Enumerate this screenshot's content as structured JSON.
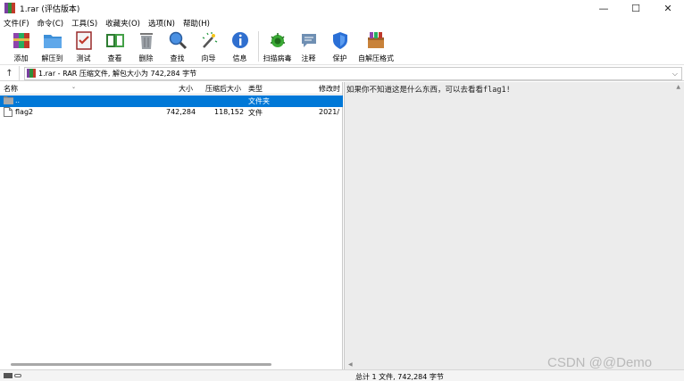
{
  "window": {
    "title": "1.rar (评估版本)",
    "controls": {
      "minimize": "—",
      "maximize": "☐",
      "close": "✕"
    }
  },
  "menu": [
    "文件(F)",
    "命令(C)",
    "工具(S)",
    "收藏夹(O)",
    "选项(N)",
    "帮助(H)"
  ],
  "toolbar": [
    {
      "label": "添加",
      "icon": "add-archive-icon"
    },
    {
      "label": "解压到",
      "icon": "extract-to-icon"
    },
    {
      "label": "测试",
      "icon": "test-icon"
    },
    {
      "label": "查看",
      "icon": "view-icon"
    },
    {
      "label": "删除",
      "icon": "delete-icon"
    },
    {
      "label": "查找",
      "icon": "find-icon"
    },
    {
      "label": "向导",
      "icon": "wizard-icon"
    },
    {
      "label": "信息",
      "icon": "info-icon"
    },
    {
      "label": "扫描病毒",
      "icon": "scan-virus-icon"
    },
    {
      "label": "注释",
      "icon": "comment-icon"
    },
    {
      "label": "保护",
      "icon": "protect-icon"
    },
    {
      "label": "自解压格式",
      "icon": "sfx-icon"
    }
  ],
  "address": {
    "up_glyph": "↑",
    "text": "1.rar - RAR 压缩文件, 解包大小为 742,284 字节",
    "dropdown_glyph": "⌵"
  },
  "columns": {
    "name": "名称",
    "size": "大小",
    "packed": "压缩后大小",
    "type": "类型",
    "modified": "修改时"
  },
  "files": [
    {
      "name": "..",
      "size": "",
      "packed": "",
      "type": "文件夹",
      "modified": "",
      "icon": "folder-icon",
      "selected": true
    },
    {
      "name": "flag2",
      "size": "742,284",
      "packed": "118,152",
      "type": "文件",
      "modified": "2021/",
      "icon": "file-icon",
      "selected": false
    }
  ],
  "comment": "如果你不知道这是什么东西，可以去看看flag1!",
  "status": {
    "text": "总计 1 文件, 742,284 字节"
  },
  "watermark": "CSDN @@Demo",
  "colors": {
    "selection": "#0078d7",
    "comment_bg": "#ececec"
  }
}
